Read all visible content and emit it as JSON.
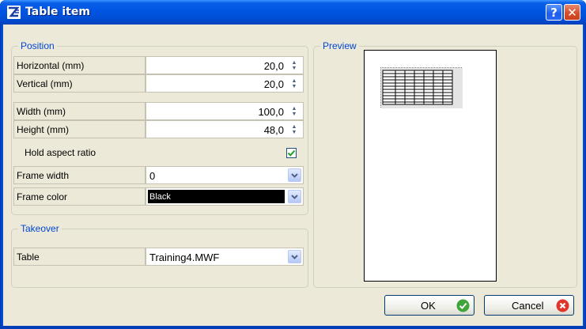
{
  "window": {
    "title": "Table item",
    "help_glyph": "?",
    "close_glyph": "✕"
  },
  "position": {
    "legend": "Position",
    "horizontal_label": "Horizontal (mm)",
    "horizontal_value": "20,0",
    "vertical_label": "Vertical (mm)",
    "vertical_value": "20,0",
    "width_label": "Width (mm)",
    "width_value": "100,0",
    "height_label": "Height (mm)",
    "height_value": "48,0",
    "aspect_label": "Hold aspect ratio",
    "aspect_checked": true,
    "frame_width_label": "Frame width",
    "frame_width_value": "0",
    "frame_color_label": "Frame color",
    "frame_color_value": "Black",
    "frame_color_hex": "#000000"
  },
  "takeover": {
    "legend": "Takeover",
    "table_label": "Table",
    "table_value": "Training4.MWF"
  },
  "preview": {
    "legend": "Preview"
  },
  "buttons": {
    "ok": "OK",
    "cancel": "Cancel"
  },
  "icons": {
    "app": "table-app-icon",
    "help": "help-icon",
    "close": "close-icon",
    "spin": "spin-updown-icon",
    "dropdown": "chevron-down-icon",
    "check": "checkmark-icon",
    "ok": "green-check-icon",
    "cancel": "red-x-icon"
  },
  "colors": {
    "title_bar": "#0054e3",
    "dialog_bg": "#ece9d8",
    "legend_text": "#0046d5",
    "ok_icon": "#3fa43a",
    "cancel_icon": "#e0352b"
  }
}
